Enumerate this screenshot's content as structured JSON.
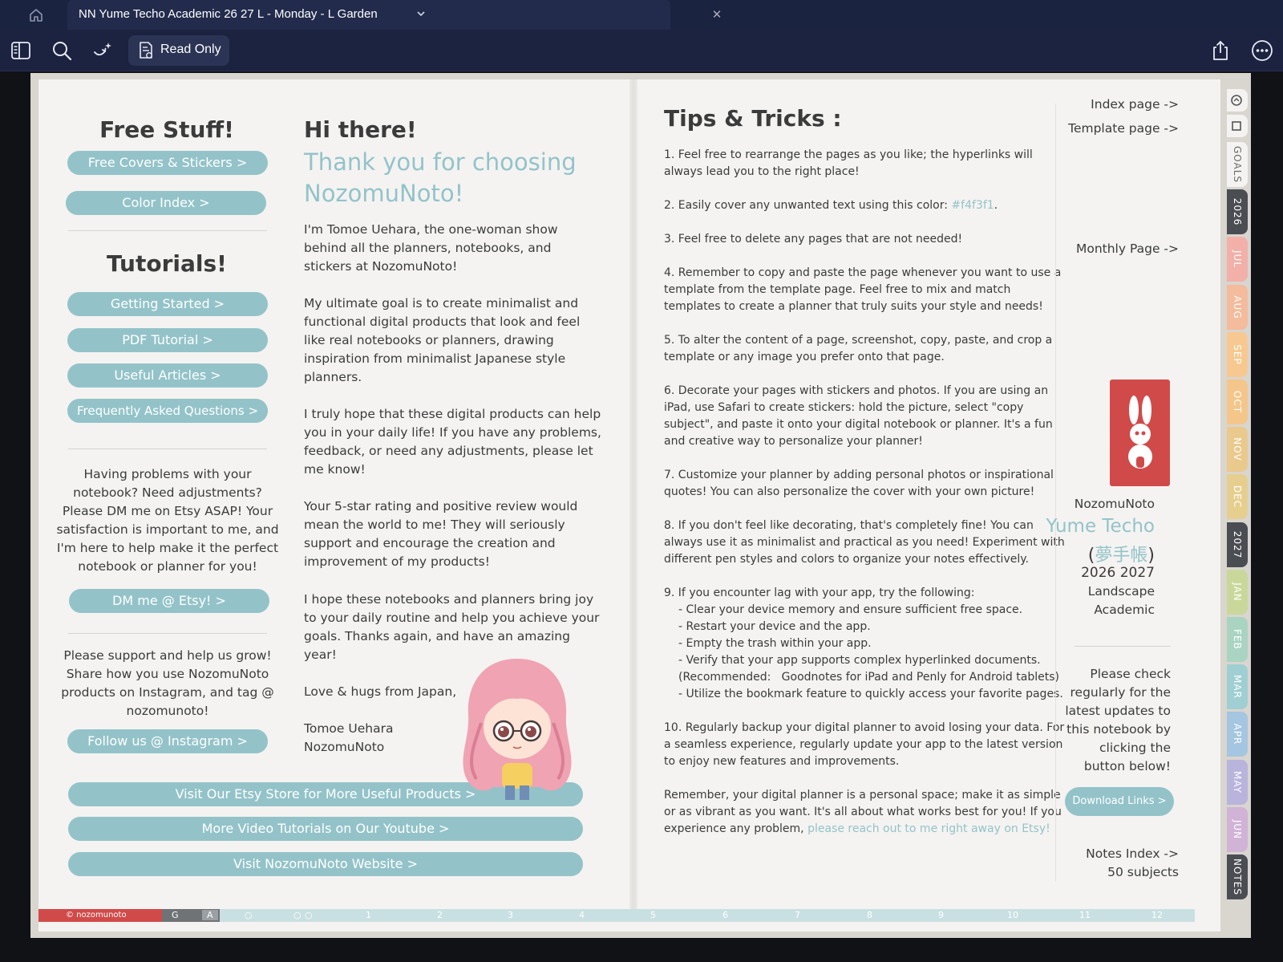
{
  "tab": {
    "title": "NN Yume Techo Academic 26 27 L - Monday - L Garden"
  },
  "toolbar": {
    "read_only_label": "Read Only"
  },
  "left": {
    "free_stuff_title": "Free Stuff!",
    "free_buttons": [
      "Free Covers & Stickers  >",
      "Color Index  >"
    ],
    "tutorials_title": "Tutorials!",
    "tutorial_buttons": [
      "Getting Started  >",
      "PDF Tutorial  >",
      "Useful Articles  >",
      "Frequently Asked Questions  >"
    ],
    "problems_text": "Having problems with your notebook? Need adjustments? Please DM me on Etsy ASAP! Your satisfaction is important to me, and I'm here to help make it the perfect notebook or planner for you!",
    "dm_button": "DM me @ Etsy!  >",
    "support_text": "Please support and help us grow! Share how you use NozomuNoto products on Instagram, and tag @ nozomunoto!",
    "instagram_button": "Follow us @ Instagram  >"
  },
  "wide_buttons": [
    "Visit Our Etsy Store for More Useful Products  >",
    "More Video Tutorials on Our Youtube  >",
    "Visit NozomuNoto Website  >"
  ],
  "middle": {
    "hi": "Hi there!",
    "thank_you": "Thank you for choosing NozomuNoto!",
    "p1": "I'm Tomoe Uehara, the one-woman show behind all the planners, notebooks, and stickers at NozomuNoto!",
    "p2": "My ultimate goal is to create minimalist and functional digital products that look and feel like real notebooks or planners, drawing inspiration from minimalist Japanese style planners.",
    "p3": "I truly hope that these digital products can help you in your daily life! If you have any problems, feedback, or need any adjustments, please let me know!",
    "p4": "Your 5-star rating and positive review would mean the world to me! They will seriously support and encourage the creation and improvement of my products!",
    "p5": "I hope these notebooks and planners bring joy to your daily routine and help you achieve your goals. Thanks again, and have an amazing year!",
    "p6": "Love & hugs from Japan,",
    "sign1": "Tomoe Uehara",
    "sign2": "NozomuNoto"
  },
  "tips": {
    "title": "Tips & Tricks :",
    "t1": "1. Feel free to rearrange the pages as you like; the hyperlinks will always lead you to the right place!",
    "t2_pre": "2. Easily cover any unwanted text using this color: ",
    "t2_color": "#f4f3f1",
    "t2_post": ".",
    "t3": "3. Feel free to delete any pages that are not needed!",
    "t4": "4. Remember to copy and paste the page whenever you want to use a template from the template page. Feel free to mix and match templates to create a planner that truly suits your style and needs!",
    "t5": "5. To alter the content of a page, screenshot, copy, paste, and crop a template or any image you prefer onto that page.",
    "t6": "6. Decorate your pages with stickers and photos. If you are using an iPad, use Safari to create stickers: hold the picture, select \"copy subject\", and paste it onto your digital notebook or planner. It's a fun and creative way to personalize your planner!",
    "t7": "7. Customize your planner by adding personal photos or inspirational quotes! You can also personalize the cover with your own picture!",
    "t8": "8. If you don't feel like decorating, that's completely fine! You can always use it as minimalist and practical as you need! Experiment with different pen styles and colors to organize your notes effectively.",
    "t9_head": "9. If you encounter lag with your app, try the following:",
    "t9_items": [
      "- Clear your device memory and ensure sufficient free space.",
      "- Restart your device and the app.",
      "- Empty the trash within your app.",
      "- Verify that your app supports complex hyperlinked documents.",
      "(Recommended:   Goodnotes for iPad and Penly for Android tablets)",
      "- Utilize the bookmark feature to quickly access your favorite pages."
    ],
    "t10": "10. Regularly backup your digital planner to avoid losing your data. For a seamless experience, regularly update your app to the latest version to enjoy new features and improvements.",
    "final_pre": "Remember, your digital planner is a personal space; make it as simple or as vibrant as you want. It's all about what works best for you! If you experience any problem, ",
    "final_link": "please reach out to me right away on Etsy!"
  },
  "sidebar": {
    "index_page": "Index page ->",
    "template_page": "Template page ->",
    "monthly_page": "Monthly Page ->",
    "brand_small": "NozomuNoto",
    "yume_techo": "Yume Techo",
    "kanji_open": "(",
    "kanji": "夢手帳",
    "kanji_close": ")",
    "years": "2026 2027",
    "landscape": "Landscape",
    "academic": "Academic",
    "updates_text": "Please check regularly for the latest updates to this notebook by clicking the button below!",
    "download_button": "Download Links  >",
    "notes_index": "Notes Index ->",
    "subjects": "50 subjects"
  },
  "side_tabs": [
    {
      "label": "GOALS",
      "color": "#f4f3f1",
      "text": "#6a6a6a"
    },
    {
      "label": "2026",
      "color": "#4a4d52",
      "text": "#ffffff"
    },
    {
      "label": "JUL",
      "color": "#f2b0a8",
      "text": "#ffffff"
    },
    {
      "label": "AUG",
      "color": "#f4bb9c",
      "text": "#ffffff"
    },
    {
      "label": "SEP",
      "color": "#f7c990",
      "text": "#ffffff"
    },
    {
      "label": "OCT",
      "color": "#f4c68a",
      "text": "#ffffff"
    },
    {
      "label": "NOV",
      "color": "#eac98c",
      "text": "#ffffff"
    },
    {
      "label": "DEC",
      "color": "#e6cf8e",
      "text": "#ffffff"
    },
    {
      "label": "2027",
      "color": "#4a4d52",
      "text": "#ffffff"
    },
    {
      "label": "JAN",
      "color": "#c9d89a",
      "text": "#ffffff"
    },
    {
      "label": "FEB",
      "color": "#a9d4c2",
      "text": "#ffffff"
    },
    {
      "label": "MAR",
      "color": "#9fcfd2",
      "text": "#ffffff"
    },
    {
      "label": "APR",
      "color": "#a4c6e0",
      "text": "#ffffff"
    },
    {
      "label": "MAY",
      "color": "#b8b4dc",
      "text": "#ffffff"
    },
    {
      "label": "JUN",
      "color": "#d0b3d6",
      "text": "#ffffff"
    },
    {
      "label": "NOTES",
      "color": "#4a4d52",
      "text": "#ffffff"
    }
  ],
  "bottom": {
    "brand": "© nozomunoto",
    "g": "G",
    "a": "A",
    "months": [
      "1",
      "2",
      "3",
      "4",
      "5",
      "6",
      "7",
      "8",
      "9",
      "10",
      "11",
      "12"
    ]
  },
  "icons": {
    "home": "home-icon",
    "chevron": "chevron-down-icon",
    "close": "close-icon",
    "sidebar": "sidebar-toggle-icon",
    "search": "search-icon",
    "magic": "magic-wand-icon",
    "read_only": "read-only-doc-icon",
    "share": "share-icon",
    "more": "more-icon"
  },
  "colors": {
    "accent": "#93c3c9",
    "page": "#f4f3f1",
    "text": "#3b3b3b",
    "stamp_red": "#d14a4a"
  }
}
